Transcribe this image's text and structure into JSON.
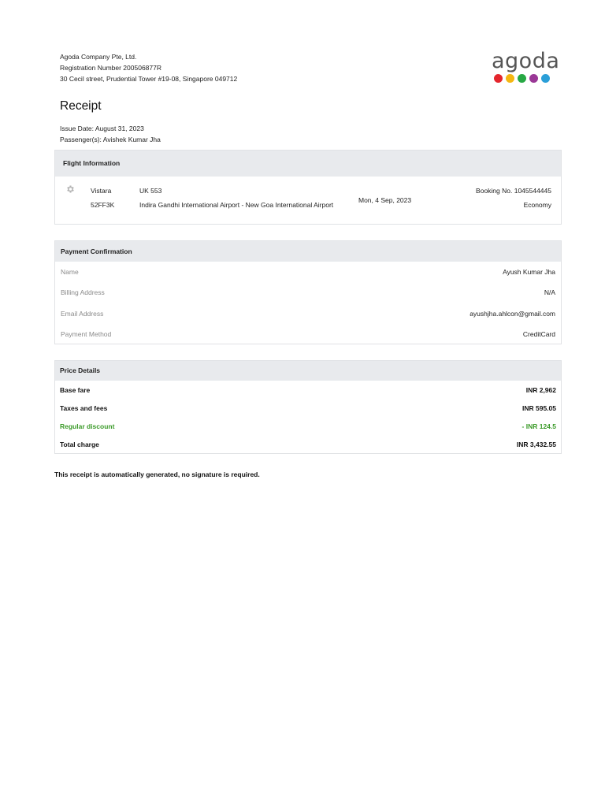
{
  "company": {
    "name": "Agoda Company Pte, Ltd.",
    "registration": "Registration Number 200506877R",
    "address": "30 Cecil street, Prudential Tower #19-08, Singapore 049712"
  },
  "logo": {
    "text": "agoda",
    "dot_colors": [
      "#e4262d",
      "#f5b712",
      "#27a844",
      "#9a3896",
      "#2b9fd8"
    ]
  },
  "receipt": {
    "title": "Receipt",
    "issue_date": "Issue Date: August 31, 2023",
    "passengers": "Passenger(s): Avishek Kumar Jha"
  },
  "flight": {
    "header": "Flight Information",
    "airline": "Vistara",
    "flight_no": "UK 553",
    "pnr": "52FF3K",
    "route": "Indira Gandhi International Airport - New Goa International Airport",
    "date": "Mon, 4 Sep, 2023",
    "booking": "Booking No. 1045544445",
    "cabin": "Economy"
  },
  "payment": {
    "header": "Payment Confirmation",
    "rows": [
      {
        "label": "Name",
        "value": "Ayush Kumar Jha"
      },
      {
        "label": "Billing Address",
        "value": "N/A"
      },
      {
        "label": "Email Address",
        "value": "ayushjha.ahlcon@gmail.com"
      },
      {
        "label": "Payment Method",
        "value": "CreditCard"
      }
    ]
  },
  "price": {
    "header": "Price Details",
    "rows": [
      {
        "label": "Base fare",
        "value": "INR 2,962"
      },
      {
        "label": "Taxes and fees",
        "value": "INR 595.05"
      },
      {
        "label": "Regular discount",
        "value": "- INR 124.5"
      },
      {
        "label": "Total charge",
        "value": "INR 3,432.55"
      }
    ],
    "discount_color": "#3a9a28"
  },
  "footer": "This receipt is automatically generated, no signature is required."
}
